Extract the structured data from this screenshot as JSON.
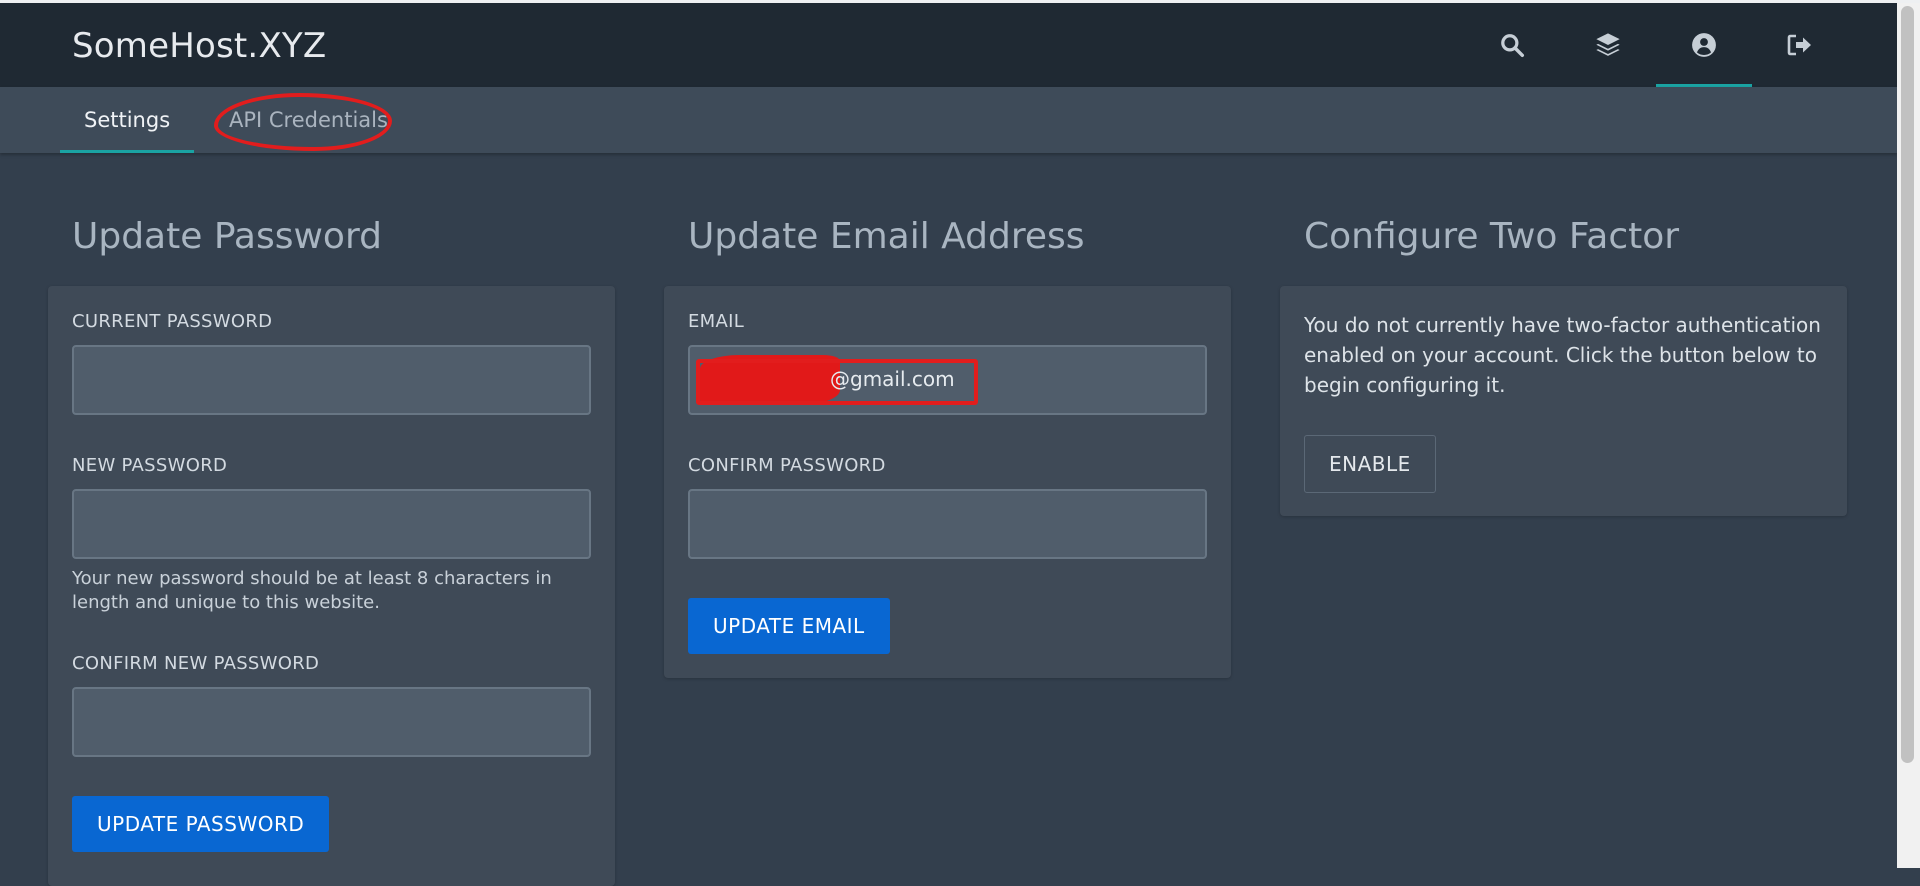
{
  "header": {
    "brand": "SomeHost.XYZ",
    "icons": [
      "search-icon",
      "layers-icon",
      "account-circle-icon",
      "sign-out-icon"
    ]
  },
  "subnav": {
    "tabs": [
      {
        "label": "Settings",
        "active": true
      },
      {
        "label": "API Credentials",
        "active": false
      }
    ]
  },
  "update_password": {
    "title": "Update Password",
    "current_label": "CURRENT PASSWORD",
    "current_value": "",
    "new_label": "NEW PASSWORD",
    "new_value": "",
    "hint": "Your new password should be at least 8 characters in length and unique to this website.",
    "confirm_label": "CONFIRM NEW PASSWORD",
    "confirm_value": "",
    "button": "UPDATE PASSWORD"
  },
  "update_email": {
    "title": "Update Email Address",
    "email_label": "EMAIL",
    "email_value": "@gmail.com",
    "confirm_label": "CONFIRM PASSWORD",
    "confirm_value": "",
    "button": "UPDATE EMAIL"
  },
  "two_factor": {
    "title": "Configure Two Factor",
    "text": "You do not currently have two-factor authentication enabled on your account. Click the button below to begin configuring it.",
    "button": "ENABLE"
  },
  "colors": {
    "header_bg": "#1f2933",
    "subnav_bg": "#3e4b59",
    "page_bg": "#333f4d",
    "card_bg": "#3f4a57",
    "accent": "#1aa3a3",
    "primary_button": "#0967d2",
    "annotation_red": "#e21d1d"
  }
}
